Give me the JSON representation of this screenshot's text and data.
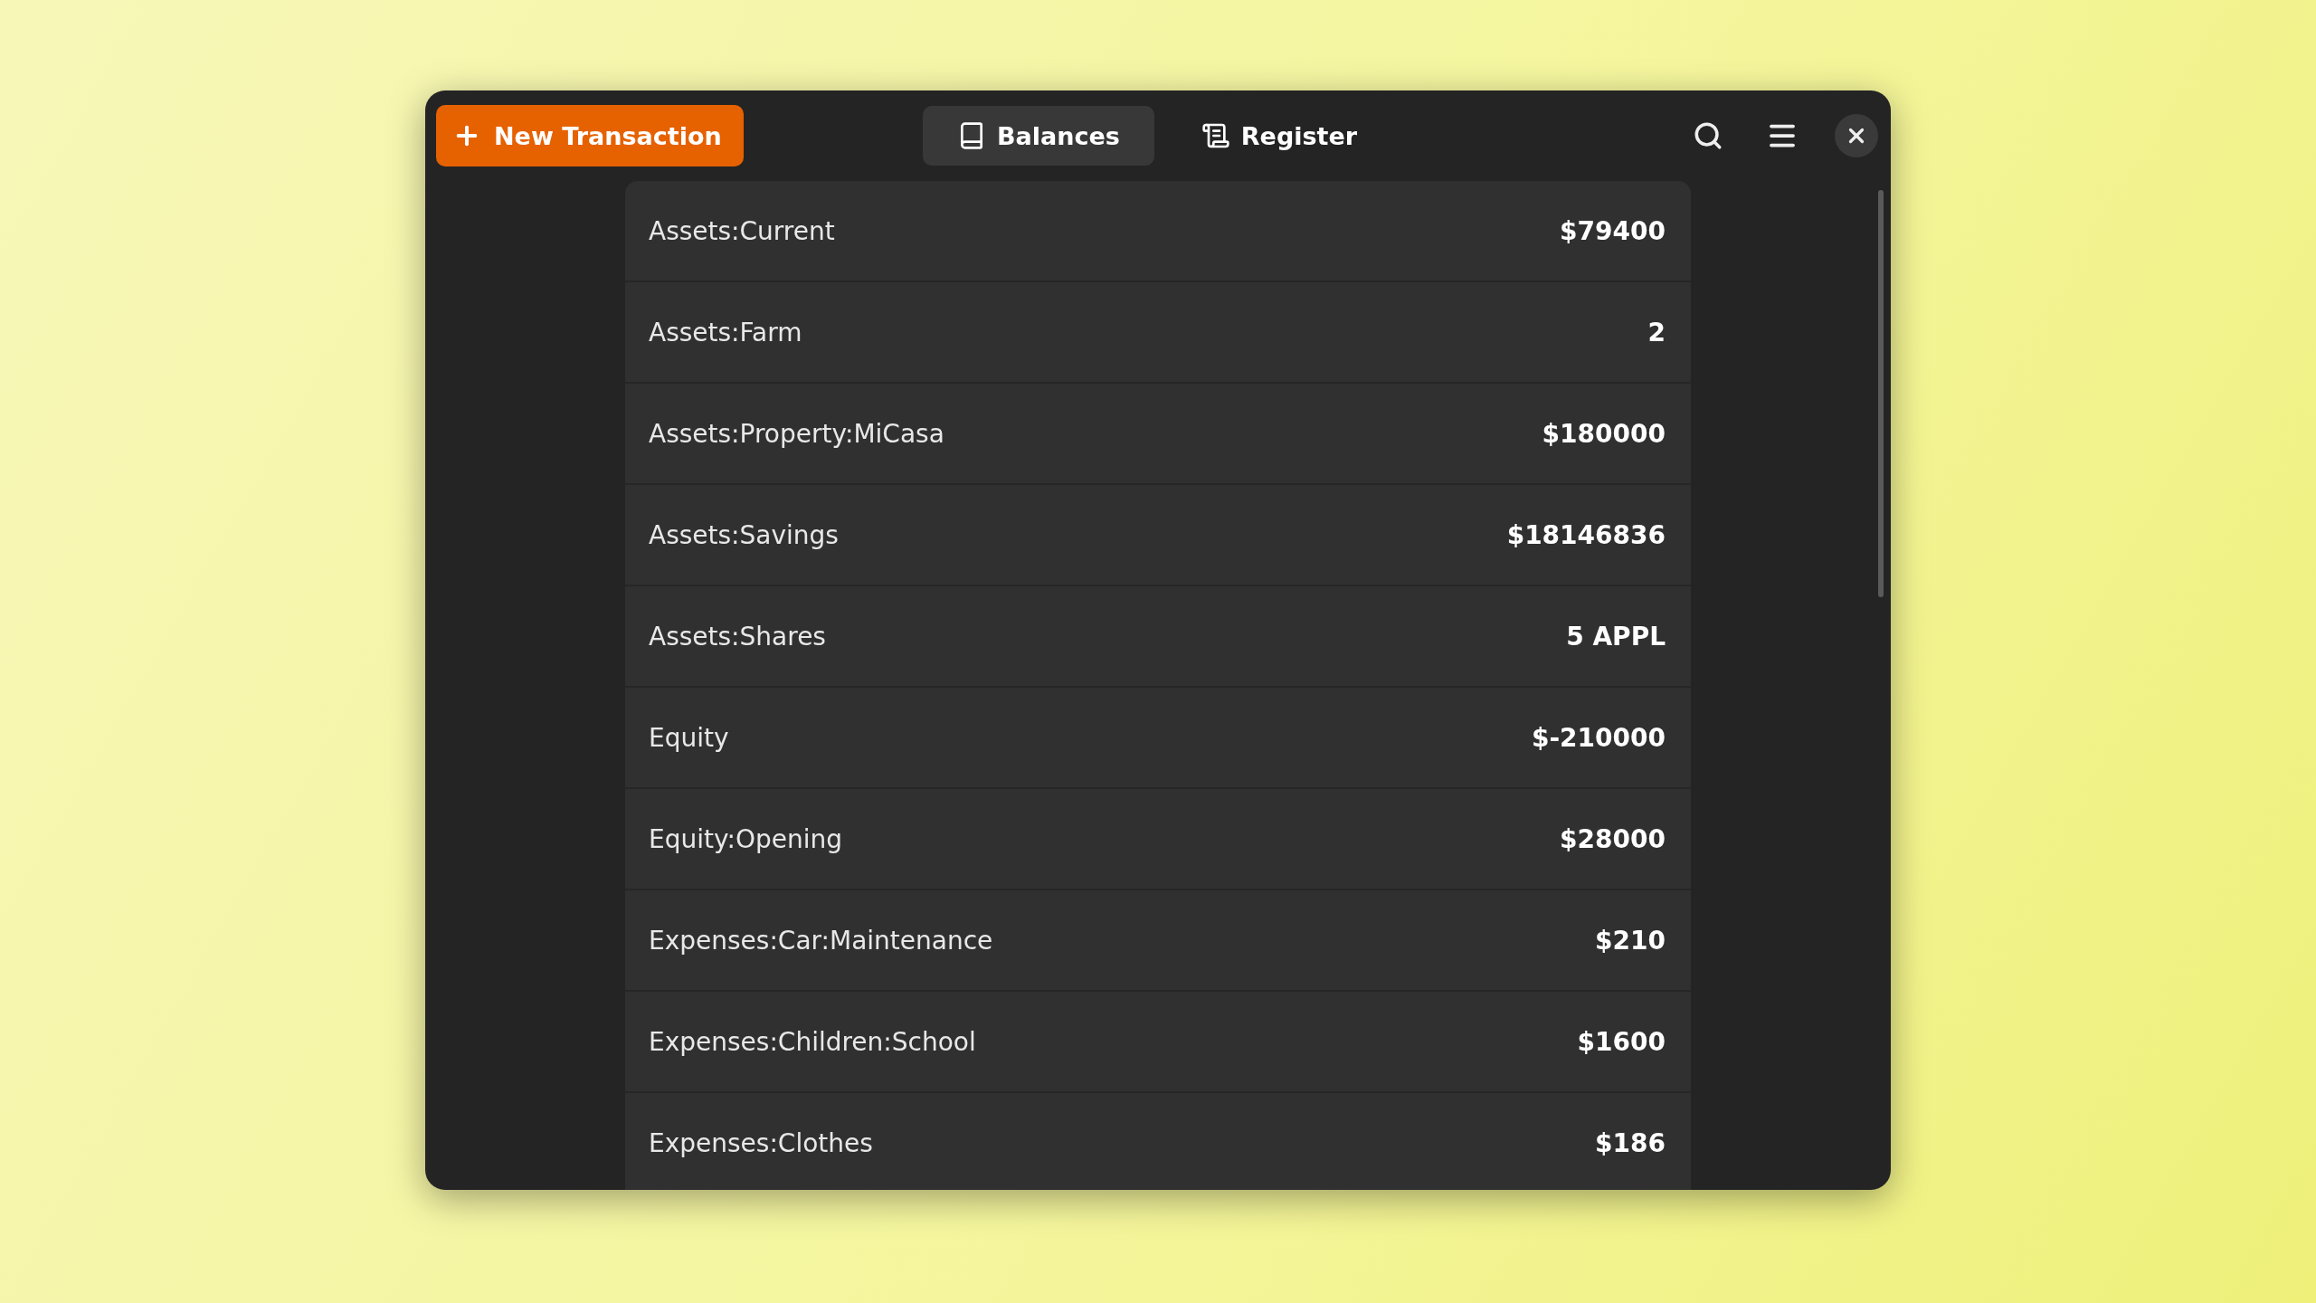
{
  "header": {
    "new_button": {
      "label": "New Transaction"
    },
    "tabs": [
      {
        "label": "Balances",
        "selected": true,
        "kind": "book"
      },
      {
        "label": "Register",
        "selected": false,
        "kind": "scroll"
      }
    ]
  },
  "accounts": [
    {
      "name": "Assets:Current",
      "balance": "$79400"
    },
    {
      "name": "Assets:Farm",
      "balance": "2"
    },
    {
      "name": "Assets:Property:MiCasa",
      "balance": "$180000"
    },
    {
      "name": "Assets:Savings",
      "balance": "$18146836"
    },
    {
      "name": "Assets:Shares",
      "balance": "5 APPL"
    },
    {
      "name": "Equity",
      "balance": "$-210000"
    },
    {
      "name": "Equity:Opening",
      "balance": "$28000"
    },
    {
      "name": "Expenses:Car:Maintenance",
      "balance": "$210"
    },
    {
      "name": "Expenses:Children:School",
      "balance": "$1600"
    },
    {
      "name": "Expenses:Clothes",
      "balance": "$186"
    }
  ]
}
